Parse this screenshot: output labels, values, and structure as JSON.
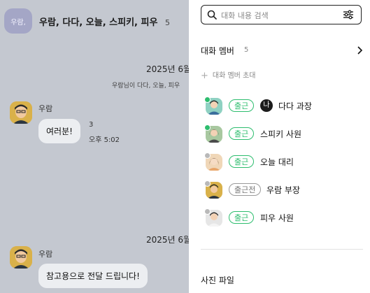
{
  "chat": {
    "room_avatar_label": "우람,",
    "room_title": "우람, 다다, 오늘, 스피키, 피우",
    "room_count": "5",
    "date_1": "2025년 6월",
    "system_message": "우람님이 다다, 오늘, 피우",
    "message_1": {
      "sender": "우람",
      "text": "여러분!",
      "read_count": "3",
      "time": "오후 5:02"
    },
    "date_2": "2025년 6월",
    "message_2": {
      "sender": "우람",
      "text": "참고용으로 전달 드립니다!"
    }
  },
  "drawer": {
    "search": {
      "placeholder": "대화 내용 검색",
      "value": ""
    },
    "members_section": {
      "title": "대화 멤버",
      "count": "5"
    },
    "invite_label": "대화 멤버 초대",
    "me_mark": "나",
    "members": [
      {
        "name": "다다 과장",
        "status": "출근",
        "is_me": true,
        "dot_color": "#2dbd6e"
      },
      {
        "name": "스피키 사원",
        "status": "출근",
        "is_me": false,
        "dot_color": "#2dbd6e"
      },
      {
        "name": "오늘 대리",
        "status": "출근",
        "is_me": false,
        "dot_color": "#b9b9b9"
      },
      {
        "name": "우람 부장",
        "status": "출근전",
        "is_me": false,
        "dot_color": "#b9b9b9"
      },
      {
        "name": "피우 사원",
        "status": "출근",
        "is_me": false,
        "dot_color": "#b9b9b9"
      }
    ],
    "photo_files_title": "사진 파일"
  },
  "colors": {
    "accent_green": "#2dbd6e",
    "overlay": "#c4c8d0"
  }
}
